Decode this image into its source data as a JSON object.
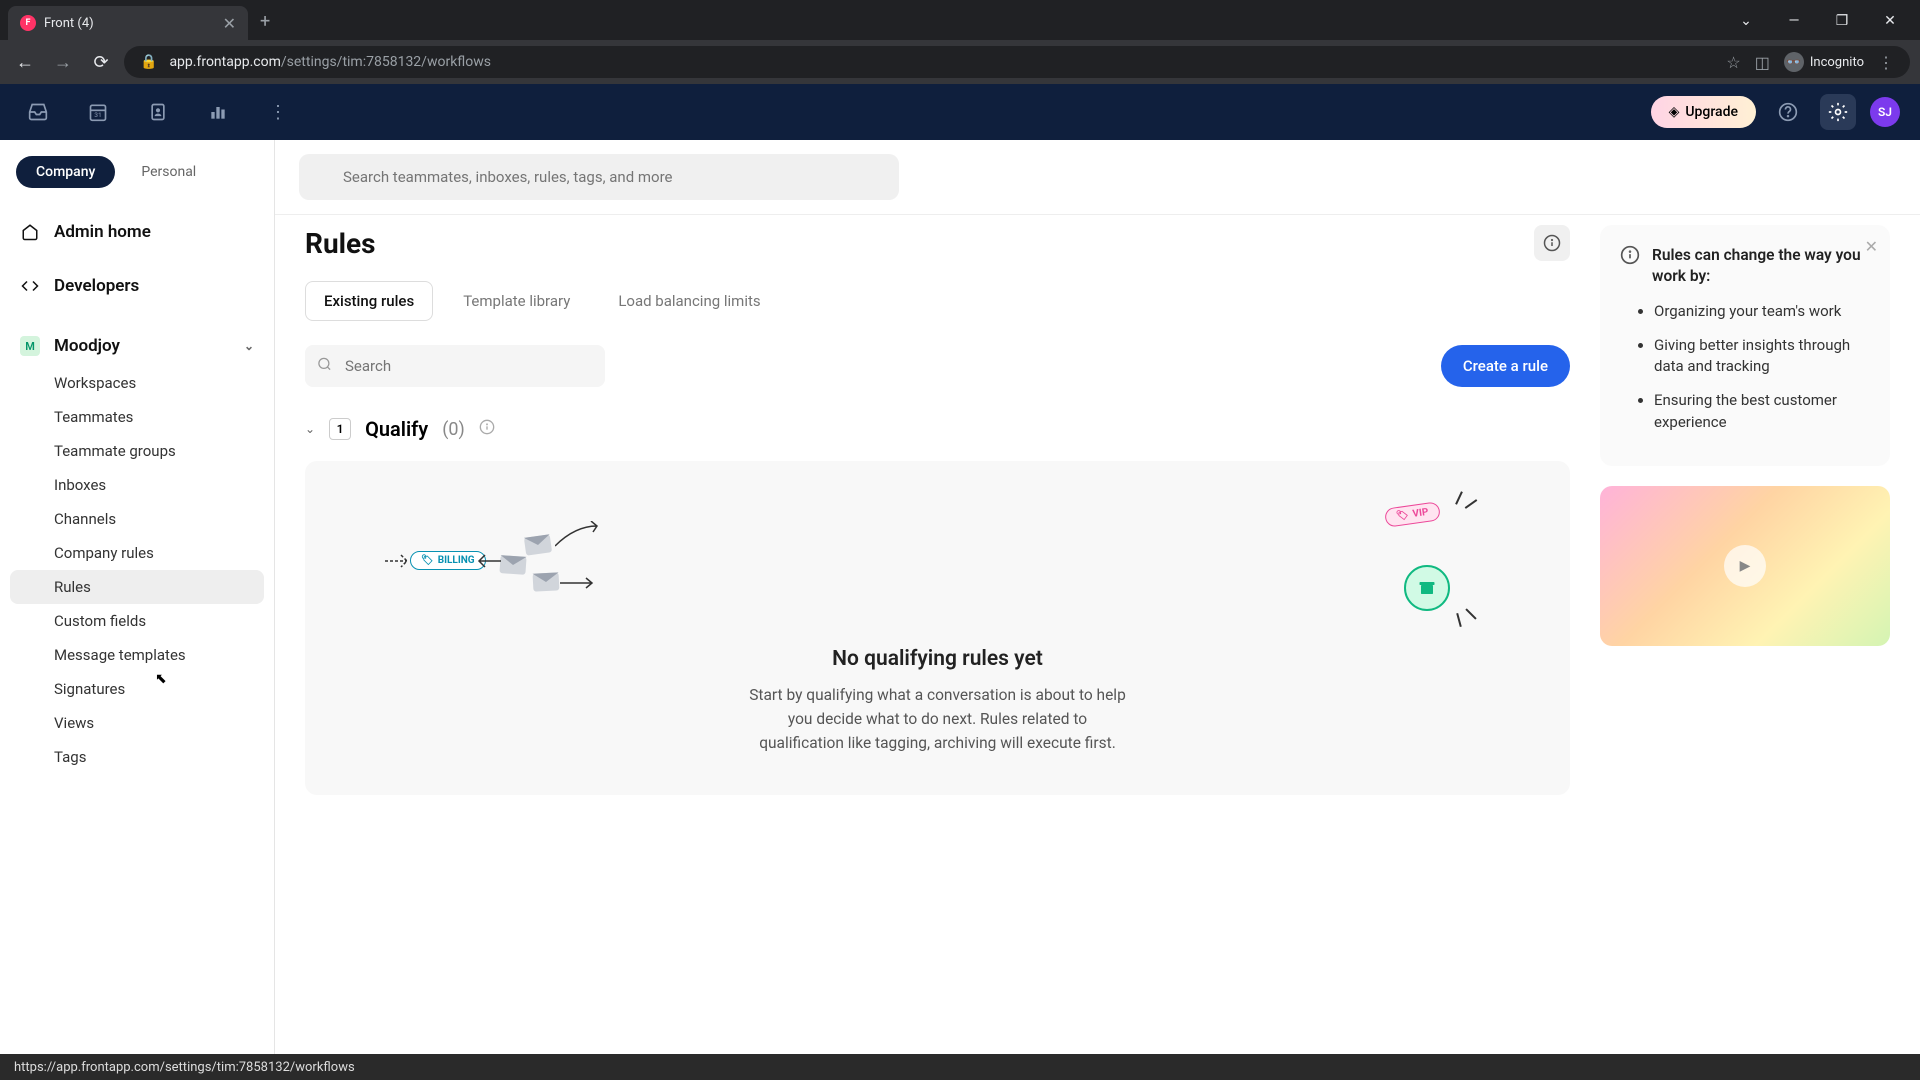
{
  "browser": {
    "tab_title": "Front (4)",
    "url_host": "app.frontapp.com",
    "url_path": "/settings/tim:7858132/workflows",
    "incognito_label": "Incognito"
  },
  "topbar": {
    "upgrade_label": "Upgrade",
    "avatar_initials": "SJ"
  },
  "sidebar": {
    "scope": {
      "company": "Company",
      "personal": "Personal"
    },
    "admin_home": "Admin home",
    "developers": "Developers",
    "workspace": {
      "badge": "M",
      "name": "Moodjoy"
    },
    "items": [
      "Workspaces",
      "Teammates",
      "Teammate groups",
      "Inboxes",
      "Channels",
      "Company rules",
      "Rules",
      "Custom fields",
      "Message templates",
      "Signatures",
      "Views",
      "Tags"
    ],
    "active_index": 6
  },
  "search": {
    "placeholder": "Search teammates, inboxes, rules, tags, and more"
  },
  "page": {
    "title": "Rules",
    "tabs": [
      "Existing rules",
      "Template library",
      "Load balancing limits"
    ],
    "active_tab": 0,
    "mini_search_placeholder": "Search",
    "create_label": "Create a rule"
  },
  "section": {
    "number": "1",
    "title": "Qualify",
    "count": "(0)"
  },
  "empty": {
    "title": "No qualifying rules yet",
    "desc": "Start by qualifying what a conversation is about to help you decide what to do next. Rules related to qualification like tagging, archiving will execute first.",
    "tag_billing": "BILLING",
    "tag_vip": "VIP"
  },
  "info_panel": {
    "title": "Rules can change the way you work by:",
    "bullets": [
      "Organizing your team's work",
      "Giving better insights through data and tracking",
      "Ensuring the best customer experience"
    ]
  },
  "status_bar": {
    "url": "https://app.frontapp.com/settings/tim:7858132/workflows"
  }
}
